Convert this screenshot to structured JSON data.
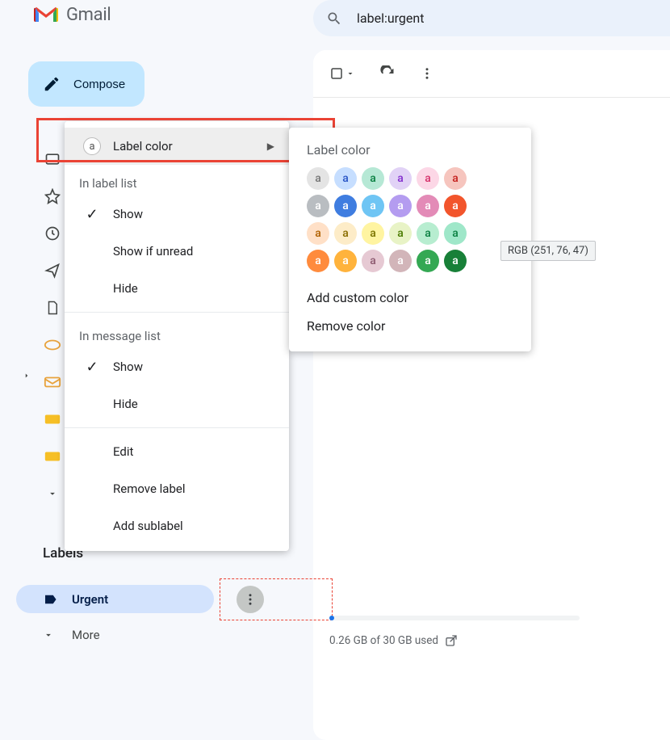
{
  "header": {
    "app_name": "Gmail",
    "search_query": "label:urgent"
  },
  "compose_label": "Compose",
  "sidebar": {
    "labels_heading": "Labels",
    "active_label": "Urgent",
    "more_label": "More"
  },
  "toolbar": {
    "select_all": "Select",
    "refresh": "Refresh",
    "more": "More"
  },
  "footer": {
    "storage_text": "0.26 GB of 30 GB used"
  },
  "menu": {
    "label_color": "Label color",
    "section_label_list": "In label list",
    "show": "Show",
    "show_if_unread": "Show if unread",
    "hide": "Hide",
    "section_message_list": "In message list",
    "show2": "Show",
    "hide2": "Hide",
    "edit": "Edit",
    "remove_label": "Remove label",
    "add_sublabel": "Add sublabel"
  },
  "flyout": {
    "title": "Label color",
    "add_custom": "Add custom color",
    "remove": "Remove color",
    "tooltip": "RGB (251, 76, 47)",
    "swatches": [
      [
        {
          "bg": "#e4e4e4",
          "fg": "#777"
        },
        {
          "bg": "#c6deff",
          "fg": "#2a56c6"
        },
        {
          "bg": "#b6e8d5",
          "fg": "#0b8043"
        },
        {
          "bg": "#e1d2f6",
          "fg": "#8430ce"
        },
        {
          "bg": "#fcd7e6",
          "fg": "#d6336c"
        },
        {
          "bg": "#f6c5be",
          "fg": "#c5221f"
        }
      ],
      [
        {
          "bg": "#b9bdc1",
          "fg": "#fff"
        },
        {
          "bg": "#3f7de0",
          "fg": "#fff"
        },
        {
          "bg": "#6fc5f4",
          "fg": "#fff"
        },
        {
          "bg": "#b49cf0",
          "fg": "#fff"
        },
        {
          "bg": "#e38bb7",
          "fg": "#fff"
        },
        {
          "bg": "#f2552c",
          "fg": "#fff"
        }
      ],
      [
        {
          "bg": "#ffe0c7",
          "fg": "#b06000"
        },
        {
          "bg": "#fdecc8",
          "fg": "#8a6d00"
        },
        {
          "bg": "#fff4a1",
          "fg": "#7b7400"
        },
        {
          "bg": "#e8f3c6",
          "fg": "#4a7b00"
        },
        {
          "bg": "#b7edd0",
          "fg": "#0b8043"
        },
        {
          "bg": "#9fe7c9",
          "fg": "#0b8043"
        }
      ],
      [
        {
          "bg": "#ff8b3d",
          "fg": "#fff"
        },
        {
          "bg": "#ffb33c",
          "fg": "#fff"
        },
        {
          "bg": "#e6c9d3",
          "fg": "#8d5a70"
        },
        {
          "bg": "#d2b5b9",
          "fg": "#fff"
        },
        {
          "bg": "#34a853",
          "fg": "#fff"
        },
        {
          "bg": "#188038",
          "fg": "#fff"
        }
      ]
    ]
  }
}
